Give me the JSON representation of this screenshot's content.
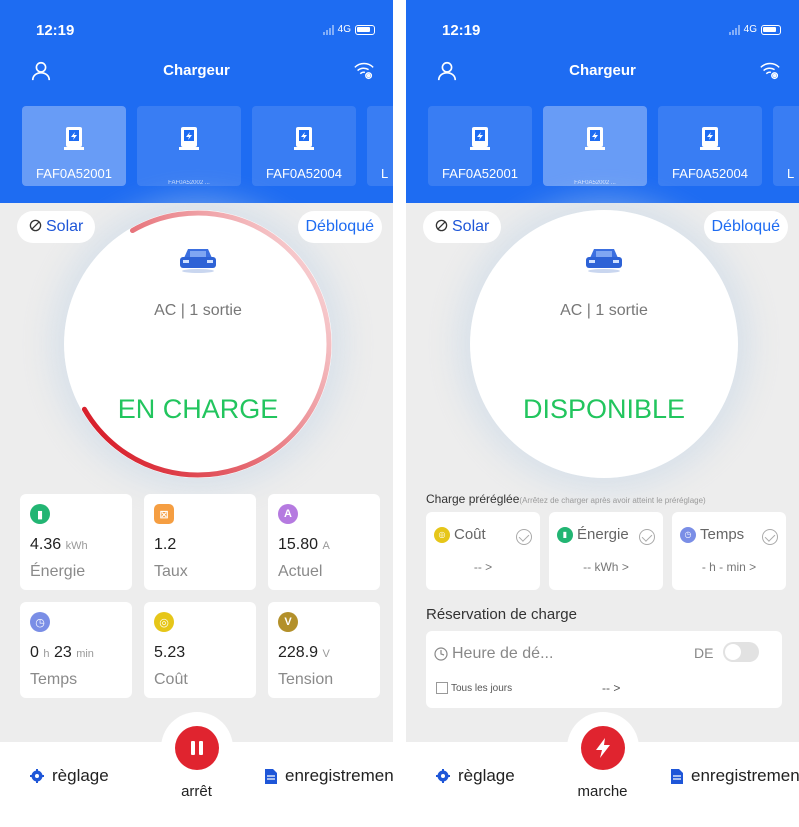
{
  "left_screen": {
    "status": {
      "time": "12:19",
      "network": "4G"
    },
    "nav": {
      "title": "Chargeur"
    },
    "chargers": [
      {
        "label": "FAF0A52001",
        "selected": true
      },
      {
        "label": "FAF0A52002 ...",
        "selected": false
      },
      {
        "label": "FAF0A52004",
        "selected": false
      },
      {
        "label": "L",
        "selected": false
      }
    ],
    "solar_label": "Solar",
    "lock_label": "Débloqué",
    "gauge": {
      "subtitle": "AC | 1 sortie",
      "status": "EN CHARGE",
      "status_color": "#22c55e",
      "ring_color": "#e0242f",
      "progress": 0.75
    },
    "metrics": [
      {
        "icon": "battery-icon",
        "color": "#22b573",
        "value": "4.36",
        "unit": "kWh",
        "label": "Énergie"
      },
      {
        "icon": "rate-icon",
        "color": "#f59e42",
        "value": "1.2",
        "unit": "",
        "label": "Taux"
      },
      {
        "icon": "current-icon",
        "color": "#b57ae0",
        "value": "15.80",
        "unit": "A",
        "label": "Actuel"
      },
      {
        "icon": "clock-icon",
        "color": "#7a8ee6",
        "value": "0",
        "unit": "h",
        "value2": "23",
        "unit2": "min",
        "label": "Temps"
      },
      {
        "icon": "coin-icon",
        "color": "#e6c619",
        "value": "5.23",
        "unit": "",
        "label": "Coût"
      },
      {
        "icon": "voltage-icon",
        "color": "#b3902a",
        "value": "228.9",
        "unit": "V",
        "label": "Tension"
      }
    ],
    "bottom": {
      "settings_label": "règlage",
      "records_label": "enregistremen",
      "center_label": "arrêt",
      "center_color": "#e0242f"
    }
  },
  "right_screen": {
    "status": {
      "time": "12:19",
      "network": "4G"
    },
    "nav": {
      "title": "Chargeur"
    },
    "chargers": [
      {
        "label": "FAF0A52001",
        "selected": false
      },
      {
        "label": "FAF0A52002 ...",
        "selected": true
      },
      {
        "label": "FAF0A52004",
        "selected": false
      },
      {
        "label": "L",
        "selected": false
      }
    ],
    "solar_label": "Solar",
    "lock_label": "Débloqué",
    "gauge": {
      "subtitle": "AC | 1 sortie",
      "status": "DISPONIBLE",
      "status_color": "#22c55e"
    },
    "preset": {
      "title": "Charge préréglée",
      "note": "(Arrêtez de charger après avoir atteint le préréglage)",
      "items": [
        {
          "icon": "coin-icon",
          "color": "#e6c619",
          "label": "Coût",
          "value": "-- >"
        },
        {
          "icon": "battery-icon",
          "color": "#22b573",
          "label": "Énergie",
          "value": "-- kWh >"
        },
        {
          "icon": "clock-icon",
          "color": "#7a8ee6",
          "label": "Temps",
          "value": "- h - min >"
        }
      ]
    },
    "reservation": {
      "title": "Réservation de charge",
      "start_label": "Heure de dé...",
      "de_label": "DE",
      "everyday_label": "Tous les jours",
      "everyday_value": "-- >"
    },
    "bottom": {
      "settings_label": "règlage",
      "records_label": "enregistremen",
      "center_label": "marche",
      "center_color": "#e0242f"
    }
  }
}
